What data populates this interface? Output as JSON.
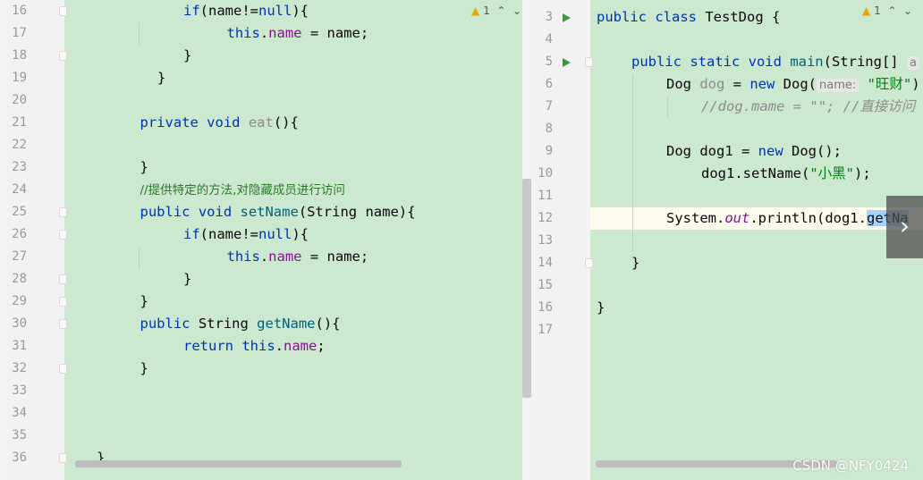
{
  "left_pane": {
    "warning_count": "1",
    "lines": [
      {
        "n": "16",
        "indent": 2,
        "t": [
          [
            "kw",
            "if"
          ],
          [
            "",
            "(name!="
          ],
          [
            "kw",
            "null"
          ],
          [
            "",
            "){"
          ]
        ]
      },
      {
        "n": "17",
        "indent": 3,
        "t": [
          [
            "kw",
            "this"
          ],
          [
            "",
            "."
          ],
          [
            "fld",
            "name"
          ],
          [
            "",
            " = name;"
          ]
        ]
      },
      {
        "n": "18",
        "indent": 2,
        "t": [
          [
            "",
            "}"
          ]
        ]
      },
      {
        "n": "19",
        "indent": 1,
        "t": [
          [
            "",
            "}"
          ]
        ],
        "off": 0.4
      },
      {
        "n": "20",
        "indent": 0,
        "t": []
      },
      {
        "n": "21",
        "indent": 1,
        "t": [
          [
            "kw",
            "private void "
          ],
          [
            "fnu",
            "eat"
          ],
          [
            "",
            "(){"
          ]
        ]
      },
      {
        "n": "22",
        "indent": 0,
        "t": []
      },
      {
        "n": "23",
        "indent": 1,
        "t": [
          [
            "",
            "}"
          ]
        ]
      },
      {
        "n": "24",
        "indent": 1,
        "t": [
          [
            "cmtc",
            "//提供特定的方法,对隐藏成员进行访问"
          ]
        ]
      },
      {
        "n": "25",
        "indent": 1,
        "t": [
          [
            "kw",
            "public void "
          ],
          [
            "fn",
            "setName"
          ],
          [
            "",
            "(String name){"
          ]
        ]
      },
      {
        "n": "26",
        "indent": 2,
        "t": [
          [
            "kw",
            "if"
          ],
          [
            "",
            "(name!="
          ],
          [
            "kw",
            "null"
          ],
          [
            "",
            "){"
          ]
        ]
      },
      {
        "n": "27",
        "indent": 3,
        "t": [
          [
            "kw",
            "this"
          ],
          [
            "",
            "."
          ],
          [
            "fld",
            "name"
          ],
          [
            "",
            " = name;"
          ]
        ]
      },
      {
        "n": "28",
        "indent": 2,
        "t": [
          [
            "",
            "}"
          ]
        ]
      },
      {
        "n": "29",
        "indent": 1,
        "t": [
          [
            "",
            "}"
          ]
        ]
      },
      {
        "n": "30",
        "indent": 1,
        "t": [
          [
            "kw",
            "public "
          ],
          [
            "",
            "String "
          ],
          [
            "fn",
            "getName"
          ],
          [
            "",
            "(){"
          ]
        ]
      },
      {
        "n": "31",
        "indent": 2,
        "t": [
          [
            "kw",
            "return this"
          ],
          [
            "",
            "."
          ],
          [
            "fld",
            "name"
          ],
          [
            "",
            ";"
          ]
        ]
      },
      {
        "n": "32",
        "indent": 1,
        "t": [
          [
            "",
            "}"
          ]
        ]
      },
      {
        "n": "33",
        "indent": 0,
        "t": []
      },
      {
        "n": "34",
        "indent": 0,
        "t": []
      },
      {
        "n": "35",
        "indent": 0,
        "t": []
      },
      {
        "n": "36",
        "indent": 0,
        "t": [
          [
            "",
            "}"
          ]
        ]
      }
    ]
  },
  "right_pane": {
    "warning_count": "1",
    "lines": [
      {
        "n": "3",
        "run": true,
        "indent": 0,
        "t": [
          [
            "kw",
            "public class "
          ],
          [
            "",
            "TestDog {"
          ]
        ]
      },
      {
        "n": "4",
        "indent": 0,
        "t": []
      },
      {
        "n": "5",
        "run": true,
        "indent": 1,
        "t": [
          [
            "kw",
            "public static void "
          ],
          [
            "fn",
            "main"
          ],
          [
            "",
            "(String[] "
          ],
          [
            "hint",
            "a"
          ]
        ]
      },
      {
        "n": "6",
        "indent": 2,
        "t": [
          [
            "",
            "Dog "
          ],
          [
            "fnu",
            "dog"
          ],
          [
            "",
            " = "
          ],
          [
            "kw",
            "new "
          ],
          [
            "",
            "Dog("
          ],
          [
            "hint",
            "name:"
          ],
          [
            "",
            " "
          ],
          [
            "str",
            "\"旺财\""
          ],
          [
            "",
            ")"
          ]
        ]
      },
      {
        "n": "7",
        "indent": 3,
        "t": [
          [
            "cmt",
            "//dog.mame = \"\"; //直接访问"
          ]
        ]
      },
      {
        "n": "8",
        "indent": 0,
        "t": []
      },
      {
        "n": "9",
        "indent": 2,
        "t": [
          [
            "",
            "Dog dog1 = "
          ],
          [
            "kw",
            "new "
          ],
          [
            "",
            "Dog();"
          ]
        ]
      },
      {
        "n": "10",
        "indent": 3,
        "t": [
          [
            "",
            "dog1.setName("
          ],
          [
            "str",
            "\"小黑\""
          ],
          [
            "",
            ");"
          ]
        ]
      },
      {
        "n": "11",
        "indent": 0,
        "t": []
      },
      {
        "n": "12",
        "indent": 2,
        "current": true,
        "t": [
          [
            "",
            "System."
          ],
          [
            "stat",
            "out"
          ],
          [
            "",
            ".println(dog1."
          ],
          [
            "sel",
            "getNa"
          ]
        ]
      },
      {
        "n": "13",
        "indent": 0,
        "t": []
      },
      {
        "n": "14",
        "indent": 1,
        "t": [
          [
            "",
            "}"
          ]
        ]
      },
      {
        "n": "15",
        "indent": 0,
        "t": []
      },
      {
        "n": "16",
        "indent": 0,
        "t": [
          [
            "",
            "}"
          ]
        ]
      },
      {
        "n": "17",
        "indent": 0,
        "t": []
      }
    ]
  },
  "nav": {
    "next_label": "›"
  },
  "watermark": "CSDN @NFY0424",
  "colors": {
    "editor_bg": "#cce8cf",
    "keyword": "#0033b3",
    "method": "#00627a",
    "field": "#871094",
    "string": "#067d17"
  }
}
